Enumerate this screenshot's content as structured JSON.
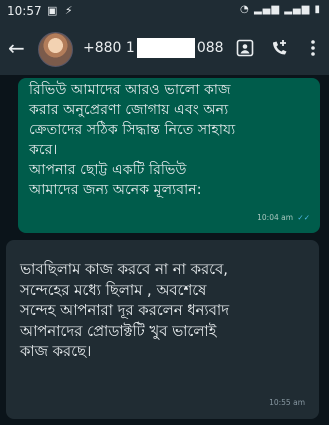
{
  "status_bar": {
    "time": "10:57",
    "left_icons": [
      "picture-icon",
      "bolt-icon"
    ],
    "right_icons": [
      "wifi-icon",
      "signal-icon",
      "signal-icon",
      "battery-icon"
    ]
  },
  "header": {
    "phone_prefix": "+880 1",
    "phone_suffix": "088",
    "back_icon": "arrow-left-icon",
    "actions": [
      "video-call-icon",
      "add-call-icon",
      "more-vertical-icon"
    ]
  },
  "messages": [
    {
      "direction": "outgoing",
      "text": "রিভিউ আমাদের আরও ভালো কাজ\nকরার অনুপ্রেরণা জোগায় এবং অন্য\nক্রেতাদের সঠিক সিদ্ধান্ত নিতে সাহায্য\nকরে।\nআপনার ছোট্ট একটি রিভিউ\nআমাদের জন্য অনেক মূল্যবান:",
      "time": "10:04 am",
      "status_icon": "double-check-icon"
    },
    {
      "direction": "incoming",
      "text": "ভাবছিলাম কাজ করবে না না করবে,\nসন্দেহের মধ্যে ছিলাম , অবশেষে\nসন্দেহ আপনারা দূর করলেন ধন্যবাদ\nআপনাদের প্রোডাক্টটি খুব ভালোই\nকাজ করছে।",
      "time": "10:55 am"
    }
  ],
  "colors": {
    "background": "#0b141a",
    "header": "#1f2c34",
    "outgoing_bubble": "#005c4b",
    "incoming_bubble": "#202c33",
    "read_ticks": "#53bdeb"
  }
}
